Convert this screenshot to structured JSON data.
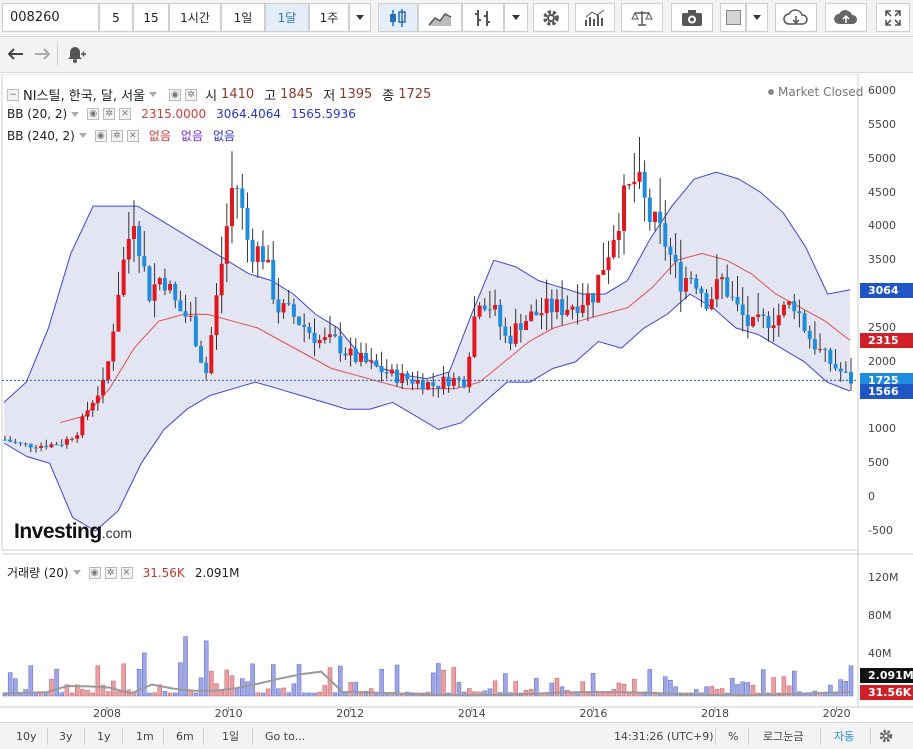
{
  "toolbar": {
    "symbol": "008260",
    "intervals": [
      "5",
      "15",
      "1시간",
      "1일",
      "1달",
      "1주"
    ],
    "active_interval": "1달"
  },
  "legend": {
    "title": "NI스틸, 한국, 달, 서울",
    "o_label": "시",
    "o": "1410",
    "h_label": "고",
    "h": "1845",
    "l_label": "저",
    "l": "1395",
    "c_label": "종",
    "c": "1725",
    "market_status": "Market Closed",
    "bb1": {
      "name": "BB (20, 2)",
      "v1": "2315.0000",
      "v2": "3064.4064",
      "v3": "1565.5936"
    },
    "bb2": {
      "name": "BB (240, 2)",
      "v1": "없음",
      "v2": "없음",
      "v3": "없음"
    },
    "volume": {
      "name": "거래량 (20)",
      "v1": "31.56K",
      "v2": "2.091M"
    }
  },
  "logo": {
    "main": "Investing",
    "suffix": ".com"
  },
  "price_axis": [
    "6000",
    "5500",
    "5000",
    "4500",
    "4000",
    "3500",
    "3000",
    "2500",
    "2000",
    "1500",
    "1000",
    "500",
    "0",
    "-500"
  ],
  "price_badges": {
    "upper": "3064",
    "mid": "2315",
    "last": "1725",
    "lower": "1566"
  },
  "volume_axis": [
    "120M",
    "80M",
    "40M"
  ],
  "volume_badges": {
    "ma": "2.091M",
    "last": "31.56K"
  },
  "x_axis": [
    "2008",
    "2010",
    "2012",
    "2014",
    "2016",
    "2018",
    "2020"
  ],
  "bottom": {
    "ranges": [
      "10y",
      "3y",
      "1y",
      "1m",
      "6m",
      "1일"
    ],
    "goto": "Go to...",
    "time": "14:31:26 (UTC+9)",
    "pct": "%",
    "log": "로그눈금",
    "auto": "자동"
  },
  "colors": {
    "up": "#e1171e",
    "down": "#1f8ddb",
    "band": "#3a46d8",
    "band_fill": "#dfe0f1",
    "mid": "#e05050",
    "vol_ma": "#9a9a9a",
    "badge_upper": "#1f55c4",
    "badge_mid": "#cf1f27",
    "badge_last": "#1f8ddb"
  },
  "chart_data": {
    "type": "candlestick",
    "x_range": [
      "2006-06",
      "2020-06"
    ],
    "y_range": [
      -700,
      6200
    ],
    "current": {
      "open": 1410,
      "high": 1845,
      "low": 1395,
      "close": 1725
    },
    "bollinger_20_2": {
      "middle": 2315,
      "upper": 3064.4064,
      "lower": 1565.5936
    },
    "volume": {
      "last": "31.56K",
      "ma20": "2.091M"
    },
    "series": {
      "close": [
        850,
        780,
        760,
        770,
        800,
        950,
        1400,
        1700,
        3200,
        4200,
        3000,
        3300,
        2800,
        2600,
        1800,
        3300,
        4800,
        3700,
        3600,
        2800,
        2700,
        2500,
        2300,
        2300,
        2100,
        2000,
        1900,
        1800,
        1750,
        1700,
        1650,
        1750,
        1700,
        3000,
        2800,
        2300,
        2600,
        2700,
        2800,
        2800,
        2900,
        3000,
        3600,
        4300,
        4700,
        4100,
        3800,
        3200,
        3300,
        2900,
        3200,
        2800,
        2500,
        2600,
        2700,
        2900,
        2400,
        2100,
        1900,
        1725
      ],
      "upper": [
        1400,
        1700,
        2500,
        3600,
        4300,
        4300,
        4300,
        4100,
        3900,
        3700,
        3500,
        3300,
        3200,
        3000,
        2700,
        2500,
        2100,
        1900,
        1800,
        1750,
        1850,
        2700,
        3500,
        3400,
        3200,
        3100,
        3000,
        3000,
        3200,
        3800,
        4300,
        4700,
        4800,
        4700,
        4500,
        4200,
        3700,
        3000,
        3064
      ],
      "lower": [
        800,
        600,
        500,
        -300,
        -500,
        -200,
        500,
        1000,
        1300,
        1500,
        1600,
        1700,
        1600,
        1500,
        1400,
        1300,
        1300,
        1400,
        1200,
        1000,
        1100,
        1400,
        1700,
        1700,
        1900,
        2000,
        2300,
        2200,
        2500,
        2700,
        3000,
        2800,
        2500,
        2400,
        2200,
        2000,
        1700,
        1566
      ],
      "middle": [
        1100,
        1200,
        1600,
        2200,
        2600,
        2700,
        2700,
        2600,
        2500,
        2300,
        2100,
        1900,
        1800,
        1700,
        1600,
        1600,
        1600,
        1700,
        2000,
        2300,
        2500,
        2600,
        2700,
        2800,
        3100,
        3500,
        3600,
        3500,
        3300,
        3000,
        2800,
        2600,
        2315
      ]
    }
  }
}
